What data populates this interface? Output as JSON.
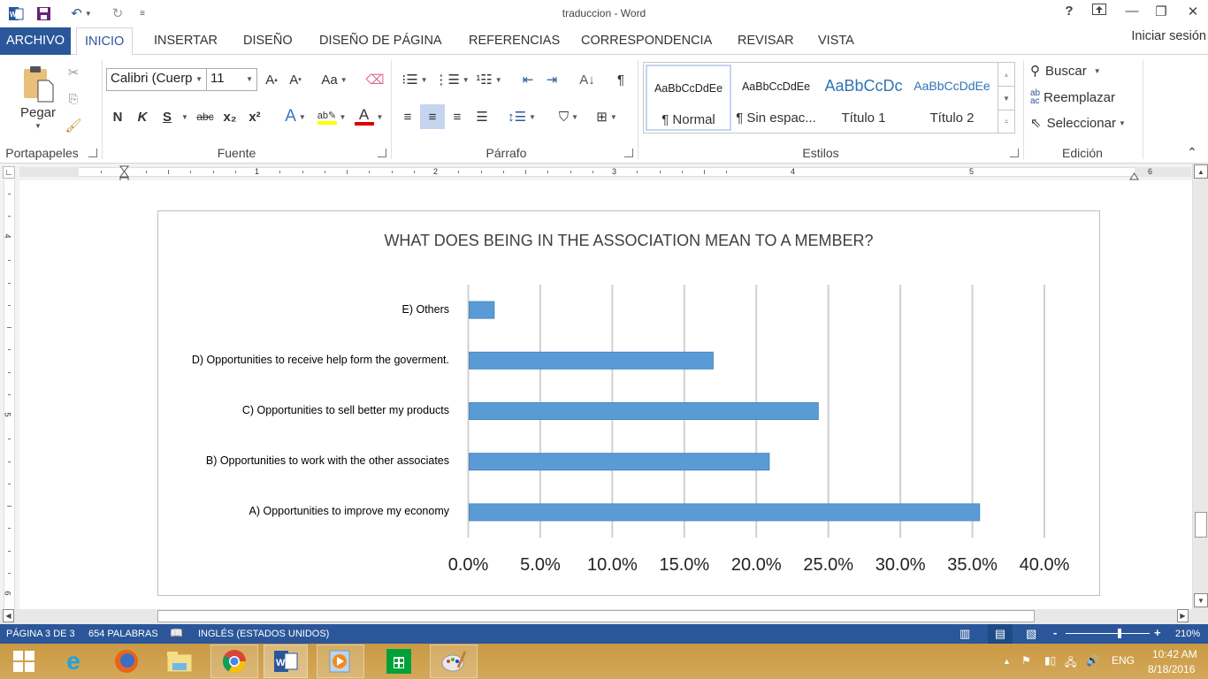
{
  "window": {
    "title": "traduccion - Word",
    "quick_access": [
      "word-logo",
      "save",
      "undo",
      "redo",
      "customize"
    ],
    "controls": {
      "help": "?",
      "ribbon_display": "⬚",
      "minimize": "—",
      "restore": "❐",
      "close": "✕"
    },
    "signin": "Iniciar sesión"
  },
  "tabs": [
    {
      "label": "ARCHIVO",
      "active": false
    },
    {
      "label": "INICIO",
      "active": true
    },
    {
      "label": "INSERTAR",
      "active": false
    },
    {
      "label": "DISEÑO",
      "active": false
    },
    {
      "label": "DISEÑO DE PÁGINA",
      "active": false
    },
    {
      "label": "REFERENCIAS",
      "active": false
    },
    {
      "label": "CORRESPONDENCIA",
      "active": false
    },
    {
      "label": "REVISAR",
      "active": false
    },
    {
      "label": "VISTA",
      "active": false
    }
  ],
  "ribbon": {
    "groups": {
      "clipboard": "Portapapeles",
      "font": "Fuente",
      "paragraph": "Párrafo",
      "styles": "Estilos",
      "editing": "Edición"
    },
    "clipboard": {
      "paste": "Pegar"
    },
    "font": {
      "name": "Calibri (Cuerp",
      "size": "11",
      "bold": "N",
      "italic": "K",
      "underline": "S",
      "strikethrough": "abc",
      "subscript": "x₂",
      "superscript": "x²",
      "change_case": "Aa",
      "highlight_color": "#ffff00",
      "font_color": "#e00000"
    },
    "styles": [
      {
        "preview": "AaBbCcDdEe",
        "name": "¶ Normal",
        "color": "#000000",
        "selected": true
      },
      {
        "preview": "AaBbCcDdEe",
        "name": "¶ Sin espac...",
        "color": "#000000",
        "selected": false
      },
      {
        "preview": "AaBbCcDc",
        "name": "Título 1",
        "color": "#2e74b5",
        "selected": false
      },
      {
        "preview": "AaBbCcDdEe",
        "name": "Título 2",
        "color": "#2e74b5",
        "selected": false
      }
    ],
    "editing": {
      "find": "Buscar",
      "replace": "Reemplazar",
      "select": "Seleccionar"
    }
  },
  "ruler": {
    "h_numbers": [
      "1",
      "2",
      "3",
      "4",
      "5",
      "6"
    ],
    "v_numbers": [
      "4",
      "5",
      "6"
    ]
  },
  "chart_data": {
    "type": "bar",
    "orientation": "horizontal",
    "title": "WHAT DOES BEING IN THE ASSOCIATION MEAN TO A MEMBER?",
    "categories": [
      "E) Others",
      "D) Opportunities to receive help form the goverment.",
      "C) Opportunities to sell better my products",
      "B) Opportunities to work with the other associates",
      "A) Opportunities to improve my economy"
    ],
    "values": [
      1.8,
      17.0,
      24.3,
      20.9,
      35.5
    ],
    "value_unit": "%",
    "xlim": [
      0,
      40
    ],
    "xticks": [
      "0.0%",
      "5.0%",
      "10.0%",
      "15.0%",
      "20.0%",
      "25.0%",
      "30.0%",
      "35.0%",
      "40.0%"
    ],
    "xlabel": "",
    "ylabel": "",
    "grid": "vertical",
    "legend": "none",
    "bar_color": "#5b9bd5"
  },
  "status": {
    "page": "PÁGINA 3 DE 3",
    "words": "654 PALABRAS",
    "language": "INGLÉS (ESTADOS UNIDOS)",
    "zoom_minus": "-",
    "zoom_plus": "+",
    "zoom": "210%"
  },
  "taskbar": {
    "apps": [
      "Inicio",
      "Internet Explorer",
      "Firefox",
      "Explorador de archivos",
      "Chrome",
      "Word",
      "Reproductor",
      "Tienda",
      "Paint"
    ],
    "language": "ENG",
    "time": "10:42 AM",
    "date": "8/18/2016"
  }
}
